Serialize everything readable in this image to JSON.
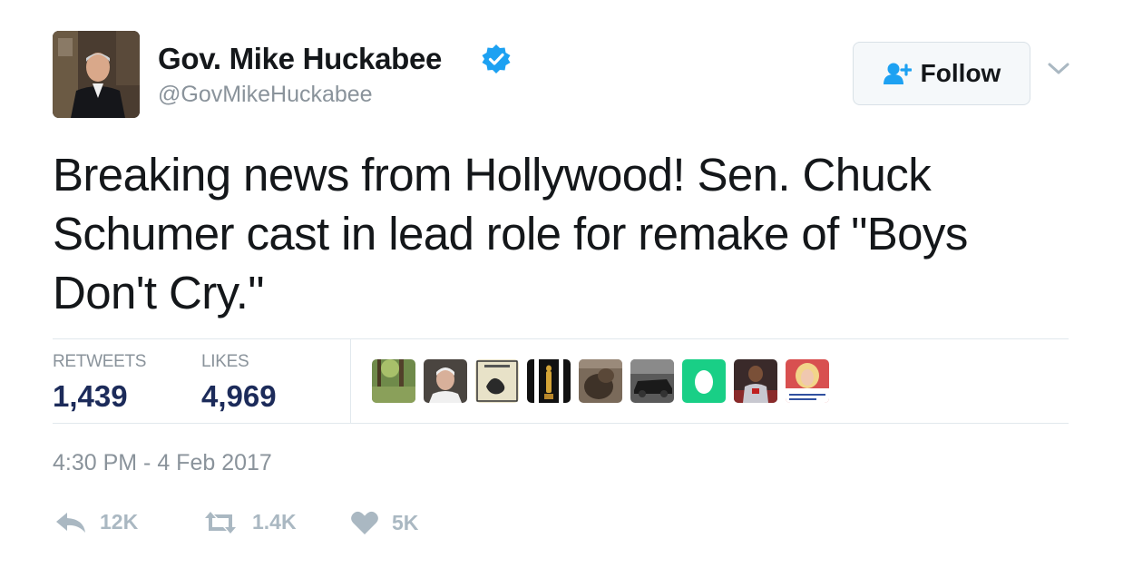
{
  "header": {
    "display_name": "Gov. Mike Huckabee",
    "handle": "@GovMikeHuckabee",
    "verified": true,
    "follow_label": "Follow"
  },
  "tweet": {
    "lines": [
      "Breaking news from Hollywood!  Sen. Chuck",
      "Schumer cast in lead role for remake of \"Boys",
      "Don't Cry.\""
    ]
  },
  "stats": {
    "retweets_label": "RETWEETS",
    "retweets_value": "1,439",
    "likes_label": "LIKES",
    "likes_value": "4,969"
  },
  "likers": [
    {
      "icon": "forest-photo-avatar"
    },
    {
      "icon": "older-man-avatar"
    },
    {
      "icon": "sketch-art-avatar"
    },
    {
      "icon": "oscar-statue-avatar"
    },
    {
      "icon": "dog-avatar"
    },
    {
      "icon": "car-avatar"
    },
    {
      "icon": "green-egg-avatar"
    },
    {
      "icon": "basketball-player-avatar"
    },
    {
      "icon": "blonde-woman-avatar"
    }
  ],
  "timestamp": "4:30 PM - 4 Feb 2017",
  "actions": {
    "reply_count": "12K",
    "retweet_count": "1.4K",
    "like_count": "5K"
  },
  "colors": {
    "verified_blue": "#1da1f2",
    "stat_value": "#1c2b5a",
    "muted": "#8a939b",
    "action_icon": "#aab8c2",
    "egg_green": "#19cf86"
  }
}
